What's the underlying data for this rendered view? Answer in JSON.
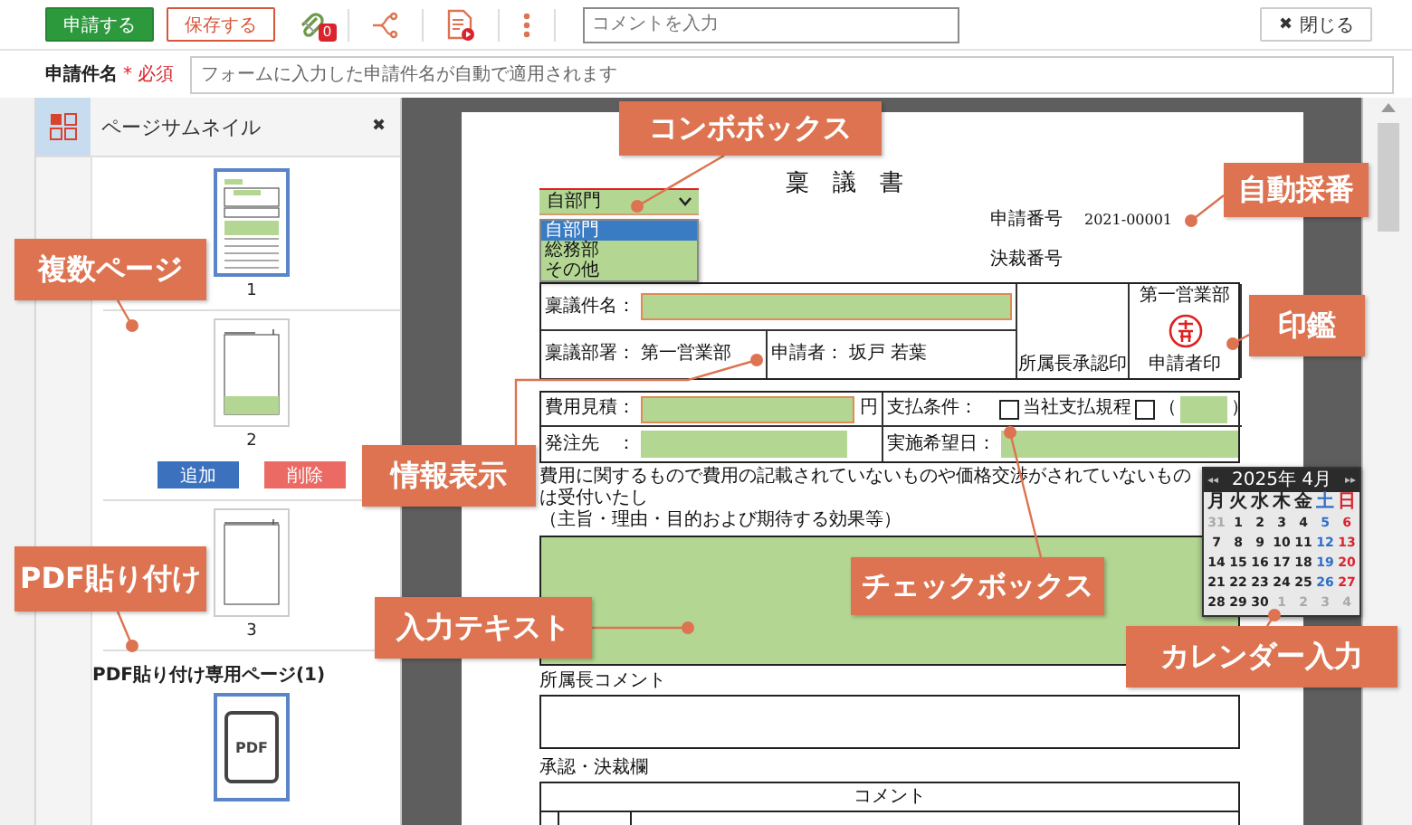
{
  "toolbar": {
    "submit_button": "申請する",
    "save_button": "保存する",
    "attachment_count": "0",
    "comment_field": {
      "placeholder": "コメントを入力"
    },
    "close_icon": "✖",
    "close_button": "閉じる"
  },
  "subject": {
    "label": "申請件名",
    "required_mark": "*",
    "required_label": "必須",
    "field": {
      "placeholder": "フォームに入力した申請件名が自動で適用されます"
    }
  },
  "thumbnail_panel": {
    "title": "ページサムネイル",
    "close_icon": "✖",
    "pages": [
      {
        "kind": "form",
        "number": "1",
        "selected": true
      },
      {
        "kind": "notes",
        "number": "2",
        "selected": false,
        "actions": [
          {
            "kind": "add",
            "label": "追加"
          },
          {
            "kind": "delete",
            "label": "削除"
          }
        ]
      },
      {
        "kind": "blank",
        "number": "3",
        "selected": false
      }
    ],
    "pdf_section": {
      "title": "PDF貼り付け専用ページ(1)",
      "pages": [
        {
          "kind": "pdf",
          "label": "PDF",
          "selected": true
        }
      ]
    }
  },
  "document": {
    "title": "稟　議　書",
    "department_combo": {
      "value": "自部門",
      "options": [
        {
          "label": "自部門",
          "selected": true
        },
        {
          "label": "総務部",
          "selected": false
        },
        {
          "label": "その他",
          "selected": false
        }
      ]
    },
    "numbers": [
      {
        "label": "申請番号",
        "value": "2021-00001"
      },
      {
        "label": "決裁番号"
      }
    ],
    "subject_field": {
      "label": "稟議件名：",
      "required": true
    },
    "department": {
      "label": "稟議部署：",
      "value": "第一営業部"
    },
    "applicant": {
      "label": "申請者：",
      "value": "坂戸 若葉"
    },
    "stamps": [
      {
        "footer": "所属長承認印",
        "sealed": false
      },
      {
        "header": "第一営業部",
        "footer": "申請者印",
        "sealed": true
      }
    ],
    "cost": {
      "label": "費用見積：",
      "unit": "円",
      "required": true
    },
    "payment": {
      "label": "支払条件：",
      "options": [
        {
          "kind": "plain",
          "label": "当社支払規程",
          "checked": false
        },
        {
          "kind": "other",
          "open": "（",
          "close": "）",
          "checked": false
        }
      ]
    },
    "vendor": {
      "label": "発注先　：",
      "required": false
    },
    "date": {
      "label": "実施希望日：",
      "required": false
    },
    "notice": "費用に関するもので費用の記載されていないものや価格交渉がされていないものは受付いたし",
    "purpose_label": "（主旨・理由・目的および期待する効果等）",
    "manager_comment_label": "所属長コメント",
    "approval_label": "承認・決裁欄",
    "approval_table": {
      "columns": [
        "コメント"
      ]
    }
  },
  "calendar": {
    "nav_left": "◂◂",
    "title": "2025年 4月",
    "nav_right": "▸▸",
    "weekdays": [
      {
        "label": "月",
        "kind": "weekday"
      },
      {
        "label": "火",
        "kind": "weekday"
      },
      {
        "label": "水",
        "kind": "weekday"
      },
      {
        "label": "木",
        "kind": "weekday"
      },
      {
        "label": "金",
        "kind": "weekday"
      },
      {
        "label": "土",
        "kind": "sat"
      },
      {
        "label": "日",
        "kind": "sun"
      }
    ],
    "weeks": [
      [
        {
          "day": "31",
          "kind": "other"
        },
        {
          "day": "1",
          "kind": "weekday"
        },
        {
          "day": "2",
          "kind": "weekday"
        },
        {
          "day": "3",
          "kind": "weekday"
        },
        {
          "day": "4",
          "kind": "weekday"
        },
        {
          "day": "5",
          "kind": "sat"
        },
        {
          "day": "6",
          "kind": "sun"
        }
      ],
      [
        {
          "day": "7",
          "kind": "weekday"
        },
        {
          "day": "8",
          "kind": "weekday"
        },
        {
          "day": "9",
          "kind": "weekday"
        },
        {
          "day": "10",
          "kind": "weekday"
        },
        {
          "day": "11",
          "kind": "weekday"
        },
        {
          "day": "12",
          "kind": "sat"
        },
        {
          "day": "13",
          "kind": "sun"
        }
      ],
      [
        {
          "day": "14",
          "kind": "weekday"
        },
        {
          "day": "15",
          "kind": "weekday"
        },
        {
          "day": "16",
          "kind": "weekday"
        },
        {
          "day": "17",
          "kind": "weekday"
        },
        {
          "day": "18",
          "kind": "weekday"
        },
        {
          "day": "19",
          "kind": "sat"
        },
        {
          "day": "20",
          "kind": "sun"
        }
      ],
      [
        {
          "day": "21",
          "kind": "weekday"
        },
        {
          "day": "22",
          "kind": "weekday"
        },
        {
          "day": "23",
          "kind": "weekday"
        },
        {
          "day": "24",
          "kind": "weekday"
        },
        {
          "day": "25",
          "kind": "weekday"
        },
        {
          "day": "26",
          "kind": "sat"
        },
        {
          "day": "27",
          "kind": "sun"
        }
      ],
      [
        {
          "day": "28",
          "kind": "weekday"
        },
        {
          "day": "29",
          "kind": "weekday"
        },
        {
          "day": "30",
          "kind": "weekday"
        },
        {
          "day": "1",
          "kind": "other"
        },
        {
          "day": "2",
          "kind": "other"
        },
        {
          "day": "3",
          "kind": "other"
        },
        {
          "day": "4",
          "kind": "other"
        }
      ]
    ]
  },
  "callouts": [
    {
      "label": "コンボボックス"
    },
    {
      "label": "自動採番"
    },
    {
      "label": "複数ページ"
    },
    {
      "label": "印鑑"
    },
    {
      "label": "情報表示"
    },
    {
      "label": "PDF貼り付け"
    },
    {
      "label": "チェックボックス"
    },
    {
      "label": "入力テキスト"
    },
    {
      "label": "カレンダー入力"
    }
  ]
}
